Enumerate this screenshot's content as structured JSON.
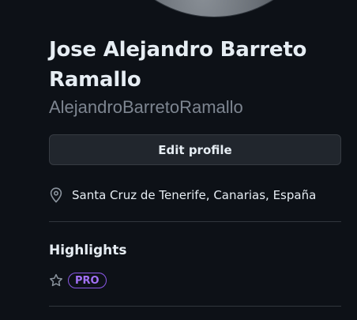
{
  "profile": {
    "full_name": "Jose Alejandro Barreto Ramallo",
    "username": "AlejandroBarretoRamallo",
    "edit_button_label": "Edit profile",
    "location": "Santa Cruz de Tenerife, Canarias, España",
    "location_icon": "location-pin-icon"
  },
  "highlights": {
    "title": "Highlights",
    "items": [
      {
        "icon": "star-icon",
        "badge": "PRO",
        "badge_color": "#a371f7"
      }
    ]
  },
  "colors": {
    "background": "#0d1117",
    "text_primary": "#e6edf3",
    "text_muted": "#7d8590",
    "button_bg": "#21262d",
    "border": "#30363d",
    "pro_accent": "#8957e5"
  }
}
